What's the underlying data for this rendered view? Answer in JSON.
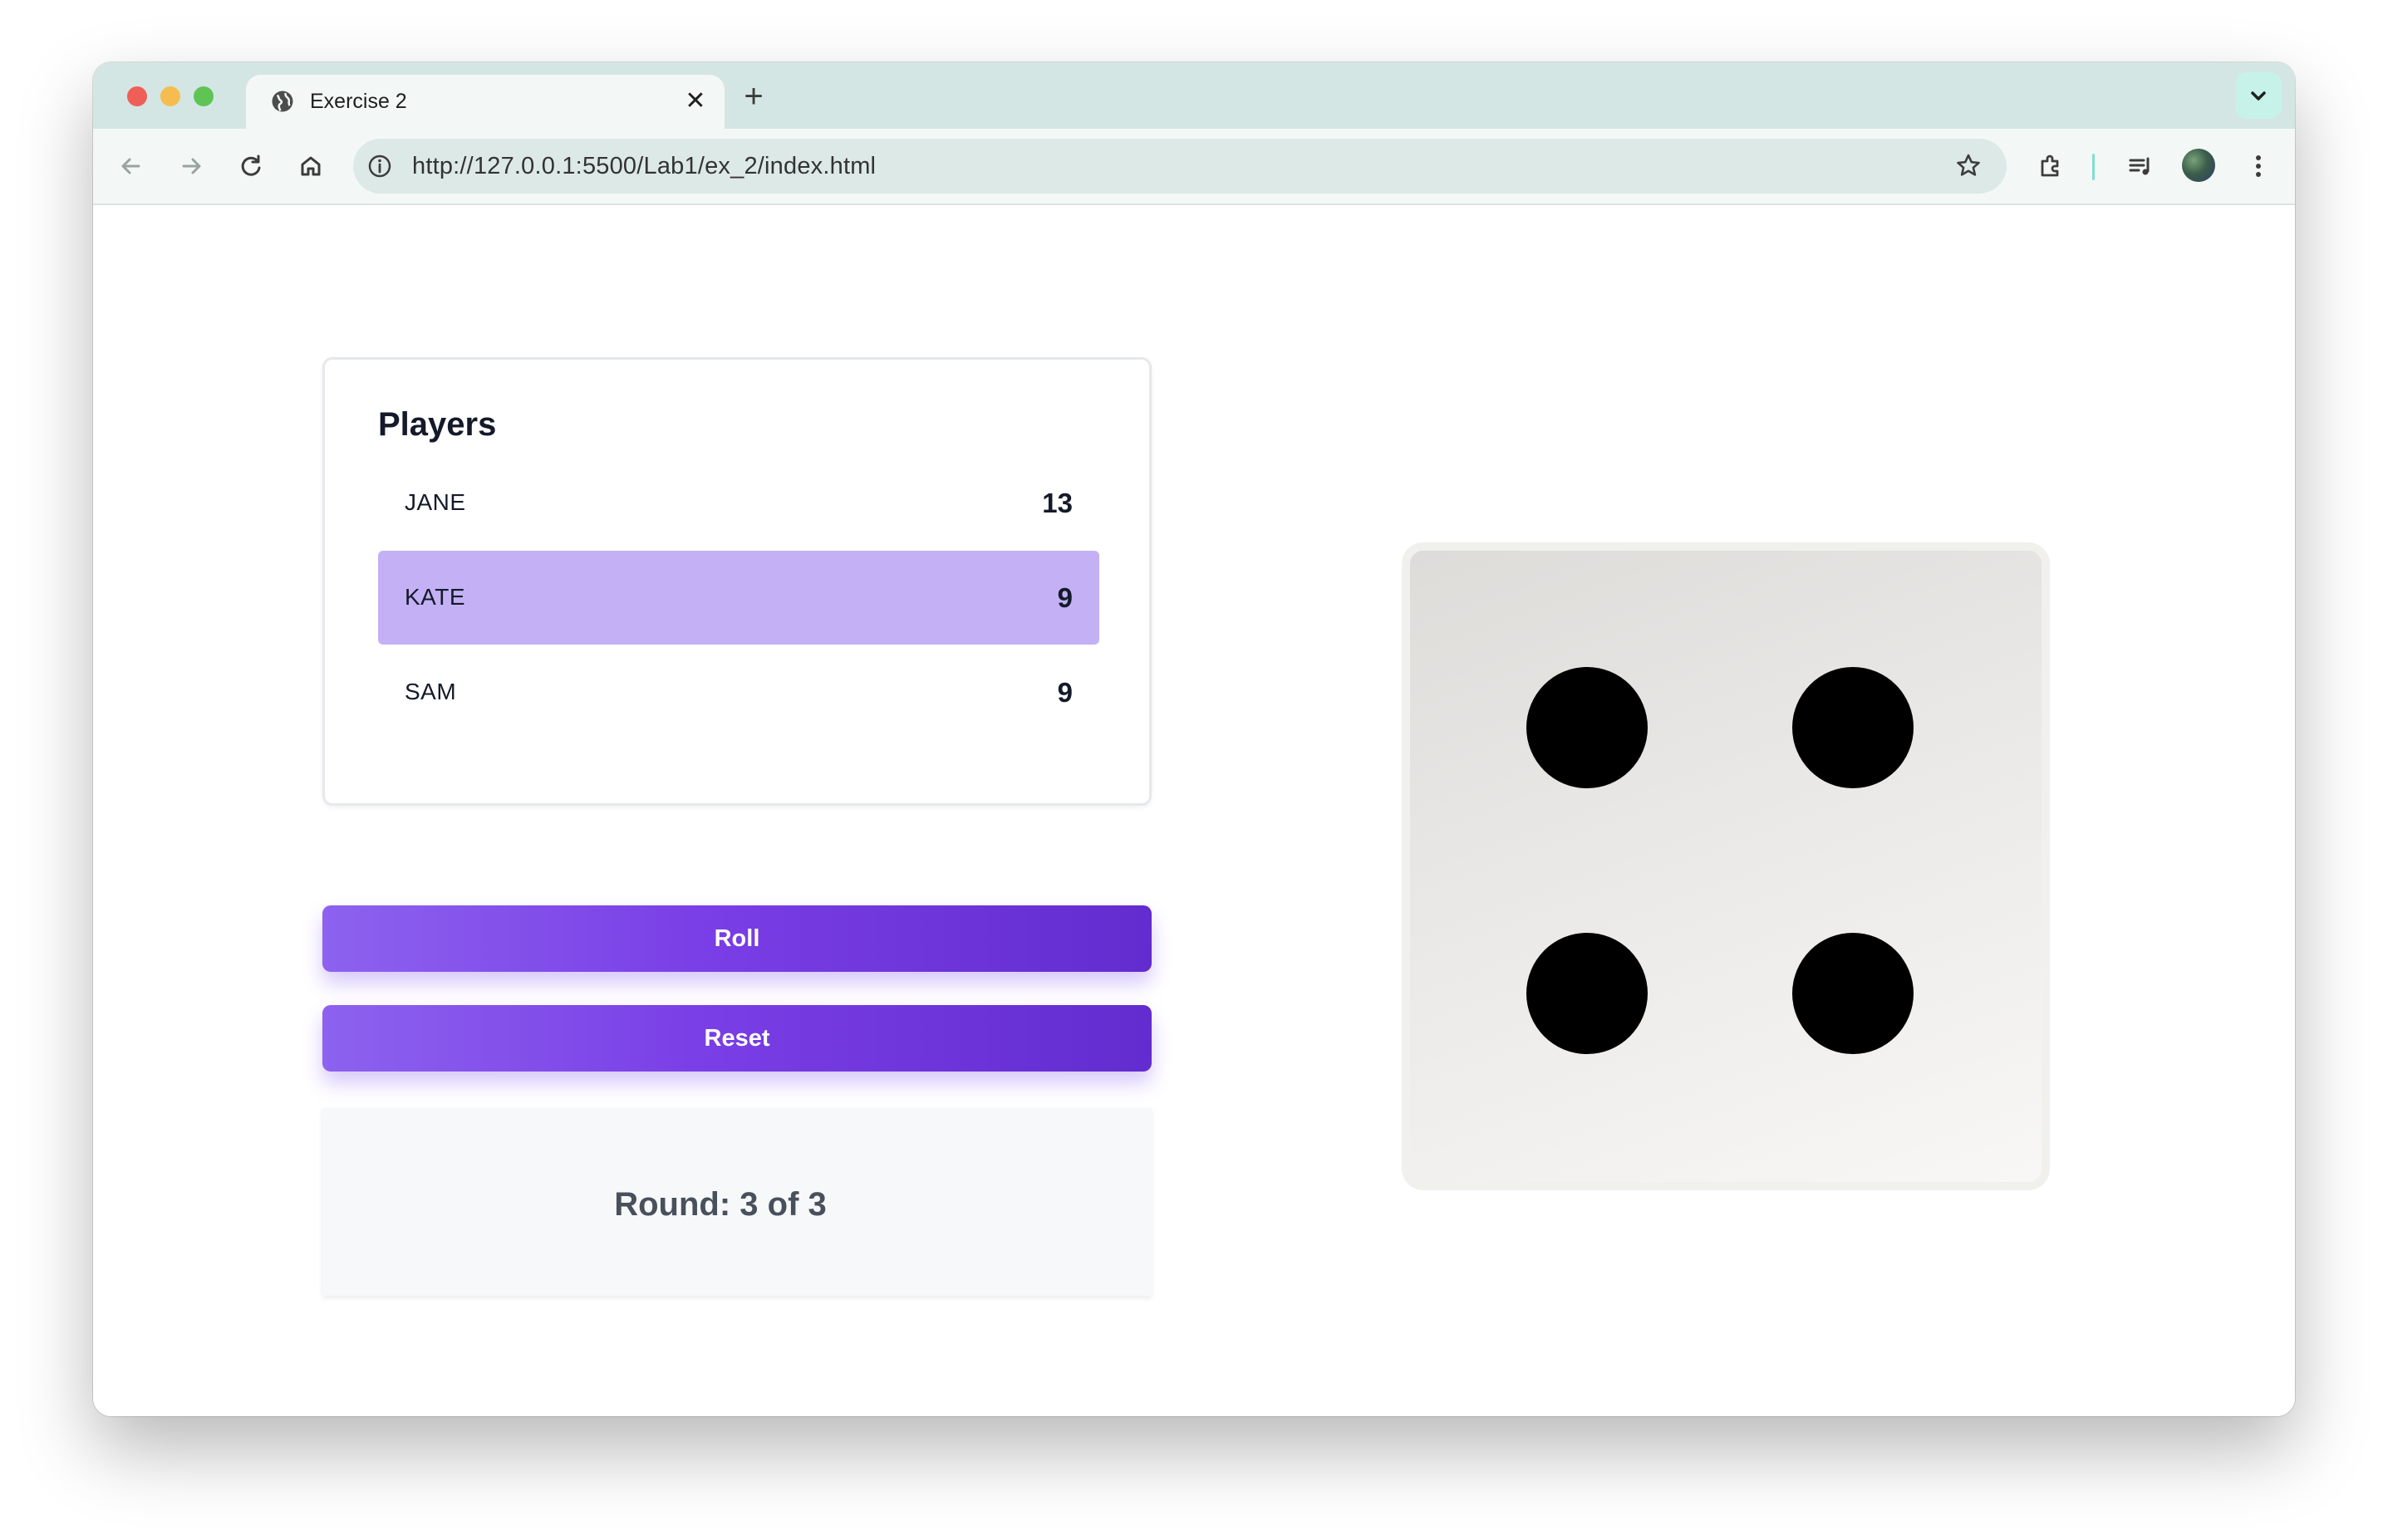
{
  "browser": {
    "tab_title": "Exercise 2",
    "tab_close": "✕",
    "new_tab": "+",
    "url": "http://127.0.0.1:5500/Lab1/ex_2/index.html",
    "icons": [
      "back-arrow-icon",
      "forward-arrow-icon",
      "reload-icon",
      "home-icon",
      "site-info-icon",
      "bookmark-star-icon",
      "extensions-icon",
      "media-controls-icon",
      "profile-avatar",
      "more-menu-icon",
      "tab-search-icon",
      "globe-icon"
    ]
  },
  "players": {
    "heading": "Players",
    "list": [
      {
        "name": "JANE",
        "score": "13",
        "active": false
      },
      {
        "name": "KATE",
        "score": "9",
        "active": true
      },
      {
        "name": "SAM",
        "score": "9",
        "active": false
      }
    ]
  },
  "buttons": {
    "roll": "Roll",
    "reset": "Reset"
  },
  "round": {
    "text": "Round: 3 of 3",
    "current": 3,
    "total": 3
  },
  "die": {
    "value": 4
  },
  "colors": {
    "accent": "#7a3fe6",
    "active_row": "#c4b1f5",
    "tab_strip": "#d3e6e3"
  }
}
